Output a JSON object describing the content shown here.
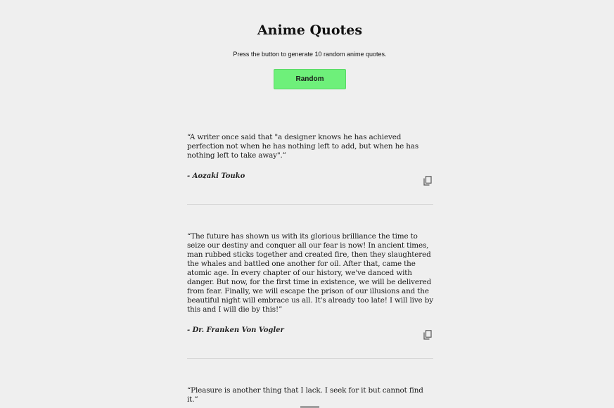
{
  "header": {
    "title": "Anime Quotes",
    "subtitle": "Press the button to generate 10 random anime quotes.",
    "button_label": "Random"
  },
  "quotes": [
    {
      "text": "“A writer once said that \"a designer knows he has achieved perfection not when he has nothing left to add, but when he has nothing left to take away\".”",
      "author": "- Aozaki Touko",
      "copy_icon": "copy-icon"
    },
    {
      "text": "“The future has shown us with its glorious brilliance the time to seize our destiny and conquer all our fear is now! In ancient times, man rubbed sticks together and created fire, then they slaughtered the whales and battled one another for oil. After that, came the atomic age. In every chapter of our history, we've danced with danger. But now, for the first time in existence, we will be delivered from fear. Finally, we will escape the prison of our illusions and the beautiful night will embrace us all. It's already too late! I will live by this and I will die by this!”",
      "author": "- Dr. Franken Von Vogler",
      "copy_icon": "copy-icon"
    },
    {
      "text": "“Pleasure is another thing that I lack. I seek for it but cannot find it.”",
      "author": "",
      "copy_icon": "copy-icon"
    }
  ],
  "colors": {
    "background": "#efefef",
    "button": "#6ef07a",
    "divider": "#d6d6d6"
  }
}
